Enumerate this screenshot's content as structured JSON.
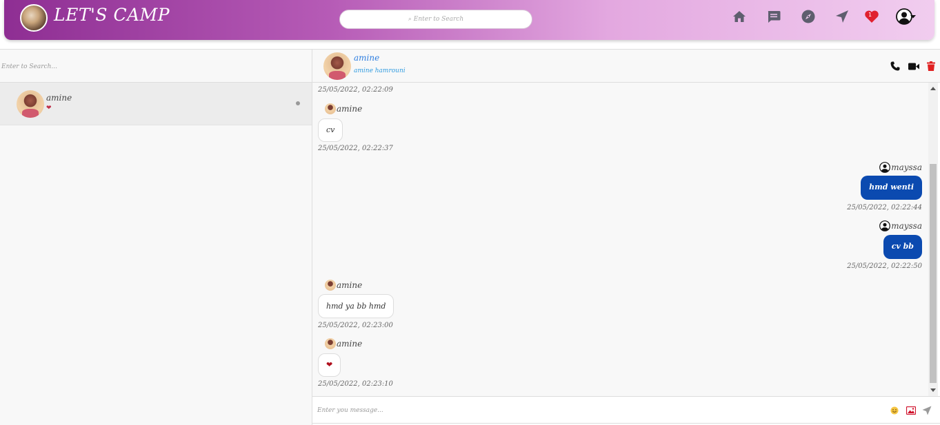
{
  "app": {
    "title": "LET'S CAMP"
  },
  "topbar": {
    "search_placeholder": "Enter to Search",
    "notifications_count": "1",
    "icons": [
      "home-icon",
      "messages-icon",
      "compass-icon",
      "send-icon",
      "heart-icon",
      "user-icon",
      "caret-down-icon"
    ]
  },
  "sidebar": {
    "search_placeholder": "Enter to Search...",
    "conversations": [
      {
        "name": "amine",
        "last_message": "❤"
      }
    ]
  },
  "chat": {
    "contact_name": "amine",
    "contact_fullname": "amine hamrouni",
    "messages": [
      {
        "type": "timestamp",
        "time": "25/05/2022, 02:22:09"
      },
      {
        "direction": "in",
        "sender": "amine",
        "text": "cv",
        "time": "25/05/2022, 02:22:37"
      },
      {
        "direction": "out",
        "sender": "mayssa",
        "text": "hmd wenti",
        "time": "25/05/2022, 02:22:44"
      },
      {
        "direction": "out",
        "sender": "mayssa",
        "text": "cv bb",
        "time": "25/05/2022, 02:22:50"
      },
      {
        "direction": "in",
        "sender": "amine",
        "text": "hmd ya bb hmd",
        "time": "25/05/2022, 02:23:00"
      },
      {
        "direction": "in",
        "sender": "amine",
        "text": "❤",
        "time": "25/05/2022, 02:23:10"
      }
    ],
    "composer_placeholder": "Enter you message..."
  },
  "colors": {
    "accent_blue": "#0b4ab0",
    "delete_red": "#e02020",
    "heart_red": "#c0304a"
  }
}
